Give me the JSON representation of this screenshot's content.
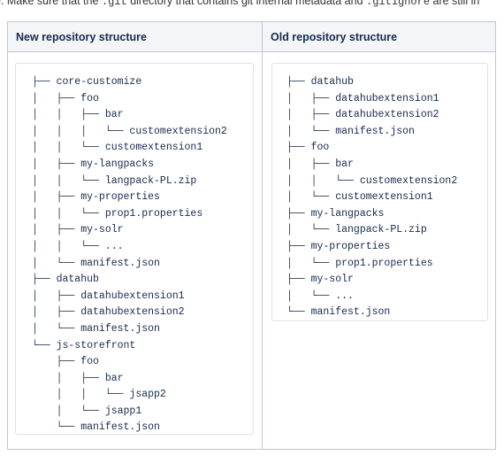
{
  "intro": {
    "prefix": "e. Make sure that the ",
    "code1": ".git",
    "middle": " directory that contains git internal metadata and ",
    "code2": ".gitignore",
    "suffix": " are still in"
  },
  "columns": [
    {
      "header": "New repository structure",
      "tree": [
        "├── core-customize",
        "│   ├── foo",
        "│   │   ├── bar",
        "│   │   │   └── customextension2",
        "│   │   └── customextension1",
        "│   ├── my-langpacks",
        "│   │   └── langpack-PL.zip",
        "│   ├── my-properties",
        "│   │   └── prop1.properties",
        "│   ├── my-solr",
        "│   │   └── ...",
        "│   └── manifest.json",
        "├── datahub",
        "│   ├── datahubextension1",
        "│   ├── datahubextension2",
        "│   └── manifest.json",
        "└── js-storefront",
        "    ├── foo",
        "    │   ├── bar",
        "    │   │   └── jsapp2",
        "    │   └── jsapp1",
        "    └── manifest.json"
      ]
    },
    {
      "header": "Old repository structure",
      "tree": [
        "├── datahub",
        "│   ├── datahubextension1",
        "│   ├── datahubextension2",
        "│   └── manifest.json",
        "├── foo",
        "│   ├── bar",
        "│   │   └── customextension2",
        "│   └── customextension1",
        "├── my-langpacks",
        "│   └── langpack-PL.zip",
        "├── my-properties",
        "│   └── prop1.properties",
        "├── my-solr",
        "│   └── ...",
        "└── manifest.json"
      ]
    }
  ]
}
